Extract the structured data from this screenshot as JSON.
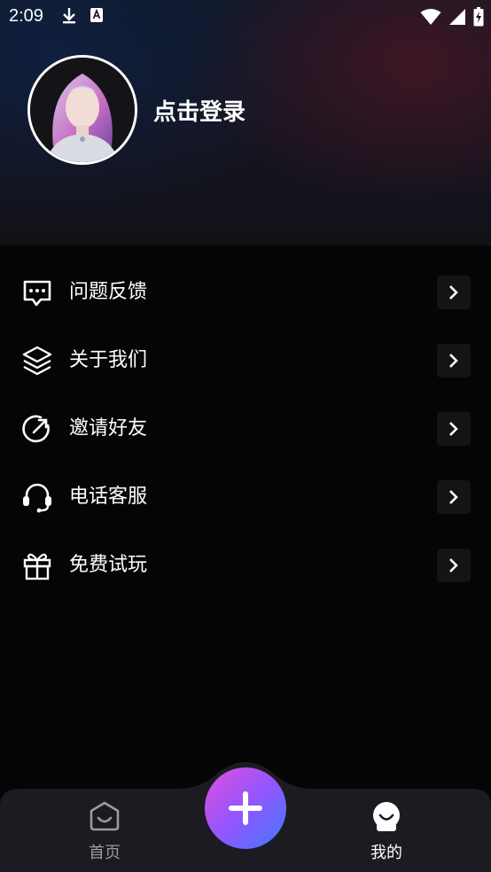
{
  "status": {
    "time": "2:09"
  },
  "profile": {
    "login_text": "点击登录"
  },
  "menu": {
    "items": [
      {
        "label": "问题反馈",
        "icon": "chat-bubble-icon"
      },
      {
        "label": "关于我们",
        "icon": "layers-icon"
      },
      {
        "label": "邀请好友",
        "icon": "arrow-circle-icon"
      },
      {
        "label": "电话客服",
        "icon": "headset-icon"
      },
      {
        "label": "免费试玩",
        "icon": "gift-icon"
      }
    ]
  },
  "nav": {
    "home_label": "首页",
    "mine_label": "我的",
    "active_color": "#ffffff",
    "inactive_color": "#9a9aa0",
    "fab_gradient": [
      "#e24de0",
      "#8a58ff",
      "#3f7bff"
    ]
  }
}
